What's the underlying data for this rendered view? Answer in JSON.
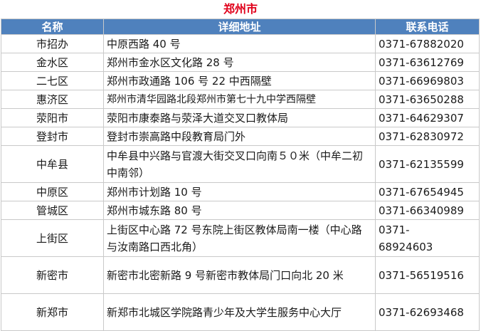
{
  "title": "郑州市",
  "colors": {
    "header_bg": "#4f81bd",
    "title_color": "#e0001a"
  },
  "columns": [
    "名称",
    "详细地址",
    "联系电话"
  ],
  "rows": [
    {
      "name": "市招办",
      "address": "中原西路 40 号",
      "phone": "0371-67882020"
    },
    {
      "name": "金水区",
      "address": "郑州市金水区文化路 28 号",
      "phone": "0371-63612769"
    },
    {
      "name": "二七区",
      "address": "郑州市政通路 106 号 22 中西隔壁",
      "phone": "0371-66969803"
    },
    {
      "name": "惠济区",
      "address": "郑州市清华园路北段郑州市第七十九中学西隔壁",
      "phone": "0371-63650288"
    },
    {
      "name": "荥阳市",
      "address": "荥阳市康泰路与荥泽大道交叉口教体局",
      "phone": "0371-64629307"
    },
    {
      "name": "登封市",
      "address": "登封市崇高路中段教育局门外",
      "phone": "0371-62830972"
    },
    {
      "name": "中牟县",
      "address": "中牟县中兴路与官渡大街交叉口向南５０米（中牟二初中南邻）",
      "phone": "0371-62135599"
    },
    {
      "name": "中原区",
      "address": "郑州市计划路 10 号",
      "phone": "0371-67654945"
    },
    {
      "name": "管城区",
      "address": "郑州市城东路 80 号",
      "phone": "0371-66340989"
    },
    {
      "name": "上街区",
      "address": "上街区中心路 72 号东院上街区教体局南一楼（中心路与汝南路口西北角）",
      "phone": "0371-68924603"
    },
    {
      "name": "新密市",
      "address": "新密市北密新路 9 号新密市教体局门口向北 20 米",
      "phone": "0371-56519516"
    },
    {
      "name": "新郑市",
      "address": "新郑市北城区学院路青少年及大学生服务中心大厅",
      "phone": "0371-62693468"
    }
  ]
}
